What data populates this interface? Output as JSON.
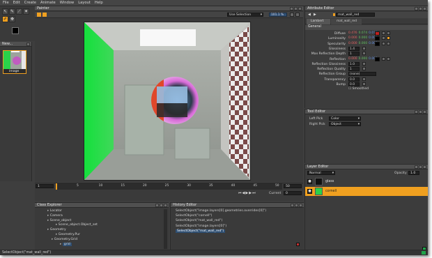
{
  "menu": [
    "File",
    "Edit",
    "Create",
    "Animate",
    "Window",
    "Layout",
    "Help"
  ],
  "thumbnail_panel": {
    "title": "New...",
    "item_label": "image"
  },
  "painter": {
    "title": "Painter",
    "camera_select": "Use Selection",
    "zoom_text": "101.1 %"
  },
  "attribute_editor": {
    "title": "Attribute Editor",
    "object_name": "mat_wall_red",
    "tabs": [
      "Lambert",
      "mat_wall_red"
    ],
    "section": "General",
    "rows": [
      {
        "label": "Diffuse",
        "r": "0.476",
        "g": "0.074",
        "b": "0.074",
        "color": "#c0201e"
      },
      {
        "label": "Luminosity",
        "r": "0.000",
        "g": "0.000",
        "b": "0.000",
        "color": "#000000"
      },
      {
        "label": "Specularity",
        "r": "0.000",
        "g": "0.000",
        "b": "0.000",
        "color": "#000000"
      },
      {
        "label": "Glossiness",
        "value": "1.4"
      },
      {
        "label": "Max Reflection Depth",
        "value": "1"
      },
      {
        "label": "Reflection",
        "r": "0.000",
        "g": "0.000",
        "b": "0.000",
        "color": "#000000"
      },
      {
        "label": "Reflection Glossiness",
        "value": "1.0"
      },
      {
        "label": "Reflection Quality",
        "value": "1"
      },
      {
        "label": "Reflection Group",
        "value": "(none)"
      },
      {
        "label": "Transparency",
        "value": "0.0"
      },
      {
        "label": "Bump",
        "value": "0.0"
      }
    ],
    "smoothed_label": "Smoothed"
  },
  "tool_editor": {
    "title": "Tool Editor",
    "left_pick_label": "Left Pick",
    "left_pick_value": "Color",
    "right_pick_label": "Right Pick",
    "right_pick_value": "Object"
  },
  "layer_editor": {
    "title": "Layer Editor",
    "blend_mode": "Normal",
    "opacity_label": "Opacity",
    "opacity_value": "1.0",
    "layers": [
      {
        "name": "glass",
        "selected": false
      },
      {
        "name": "cornell",
        "selected": true
      }
    ]
  },
  "timeline": {
    "start": "1",
    "ticks": [
      "5",
      "10",
      "15",
      "20",
      "25",
      "30",
      "35",
      "40",
      "45",
      "50"
    ],
    "end": "50",
    "current_label": "Current",
    "current": "0"
  },
  "class_explorer": {
    "title": "Class Explorer",
    "items": [
      {
        "label": "Locator",
        "indent": 3
      },
      {
        "label": "Camera",
        "indent": 3
      },
      {
        "label": "Scene_object",
        "indent": 3
      },
      {
        "label": "Scene_object.Object_set",
        "indent": 5
      },
      {
        "label": "Geometry",
        "indent": 3
      },
      {
        "label": "Geometry.Pur",
        "indent": 5
      },
      {
        "label": "Geometry.Grid",
        "indent": 4
      },
      {
        "label": "grid",
        "indent": 6
      }
    ]
  },
  "history_editor": {
    "title": "History Editor",
    "items": [
      "SelectObject(\"image.layers[0].geometries.overrides[0]\")",
      "SelectObject(\"cornell\")",
      "SelectObject(\"mat_wall_red\")",
      "SelectObject(\"image.layers[0]\")",
      "SelectObject(\"mat_wall_red\")"
    ]
  },
  "status_bar": {
    "text": "SelectObject(\"mat_wall_red\")"
  },
  "colors": {
    "accent": "#f0a020",
    "panel": "#3e3e3e",
    "header": "#505050",
    "selection": "#2f4f72"
  }
}
